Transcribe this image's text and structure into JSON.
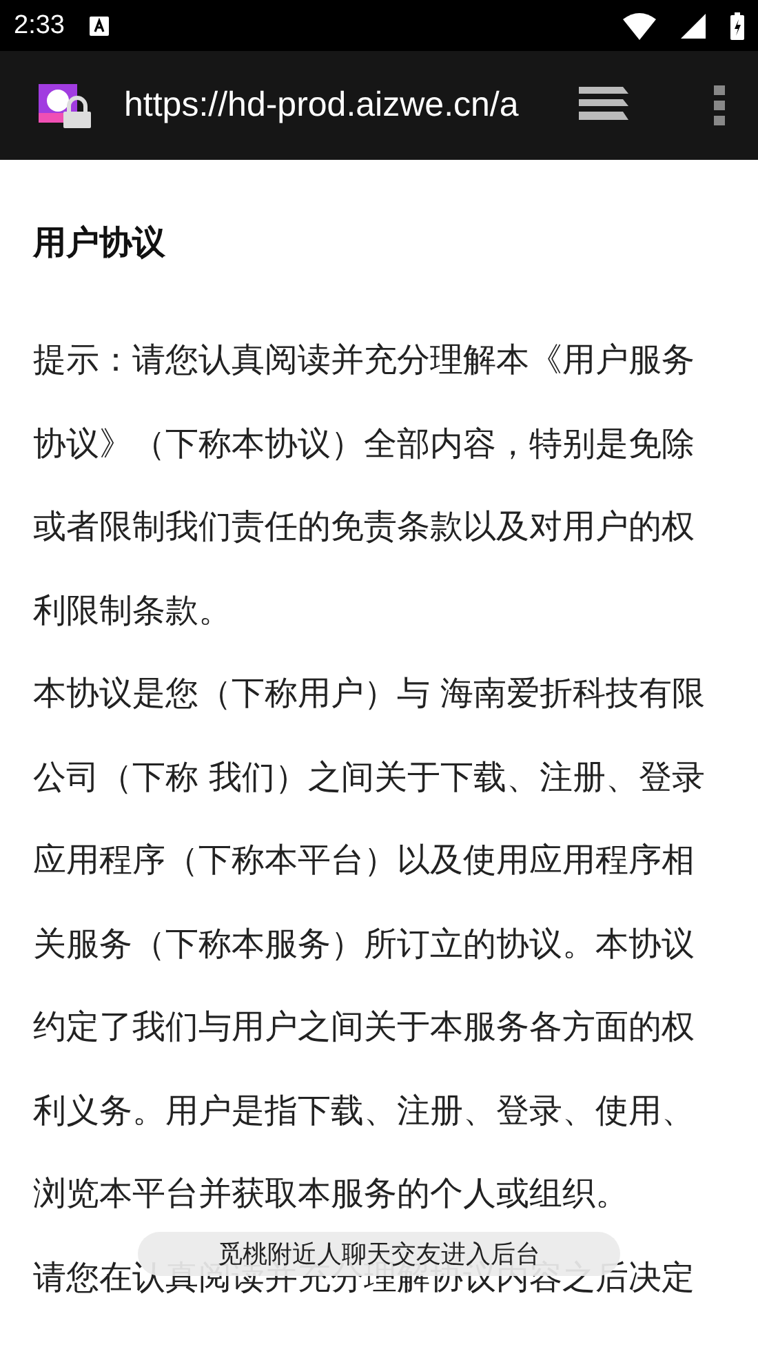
{
  "status_bar": {
    "time": "2:33"
  },
  "toolbar": {
    "url": "https://hd-prod.aizwe.cn/a"
  },
  "article": {
    "title": "用户协议",
    "paragraphs": [
      "提示：请您认真阅读并充分理解本《用户服务协议》（下称本协议）全部内容，特别是免除或者限制我们责任的免责条款以及对用户的权利限制条款。",
      "本协议是您（下称用户）与 海南爱折科技有限公司（下称 我们）之间关于下载、注册、登录应用程序（下称本平台）以及使用应用程序相关服务（下称本服务）所订立的协议。本协议约定了我们与用户之间关于本服务各方面的权利义务。用户是指下载、注册、登录、使用、浏览本平台并获取本服务的个人或组织。",
      "请您在认真阅读并充分理解协议内容之后决定"
    ]
  },
  "toast": {
    "message": "觅桃附近人聊天交友进入后台"
  }
}
